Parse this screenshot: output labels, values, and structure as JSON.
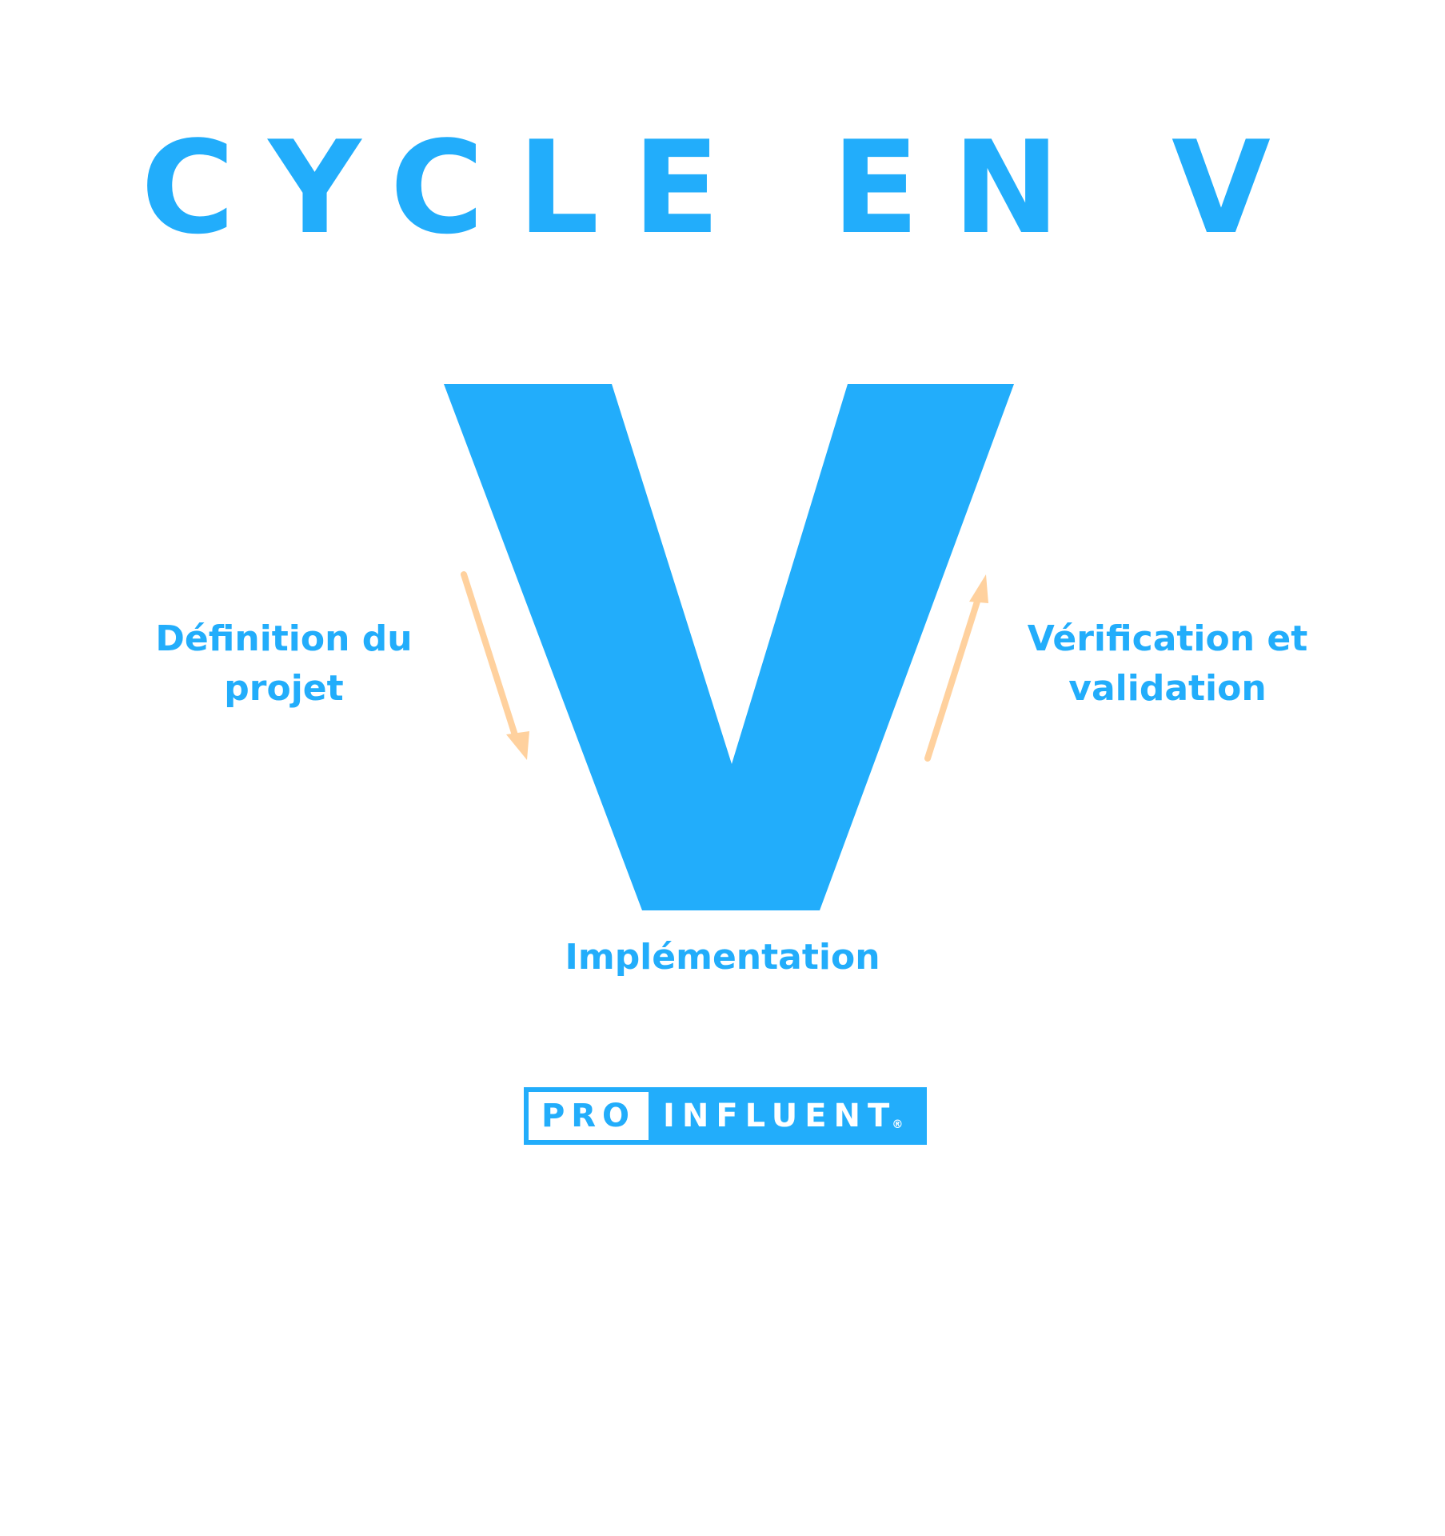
{
  "title": "CYCLE EN V",
  "labels": {
    "left": [
      "Définition du",
      "projet"
    ],
    "right": [
      "Vérification et",
      "validation"
    ],
    "bottom": "Implémentation"
  },
  "logo": {
    "pro": "PRO",
    "influent": "INFLUENT",
    "registered": "®"
  },
  "colors": {
    "accent": "#22adfb",
    "arrow": "#ffd19e",
    "background": "#ffffff"
  },
  "icons": {
    "left_arrow": "arrow-down-right-icon",
    "right_arrow": "arrow-up-right-icon"
  }
}
